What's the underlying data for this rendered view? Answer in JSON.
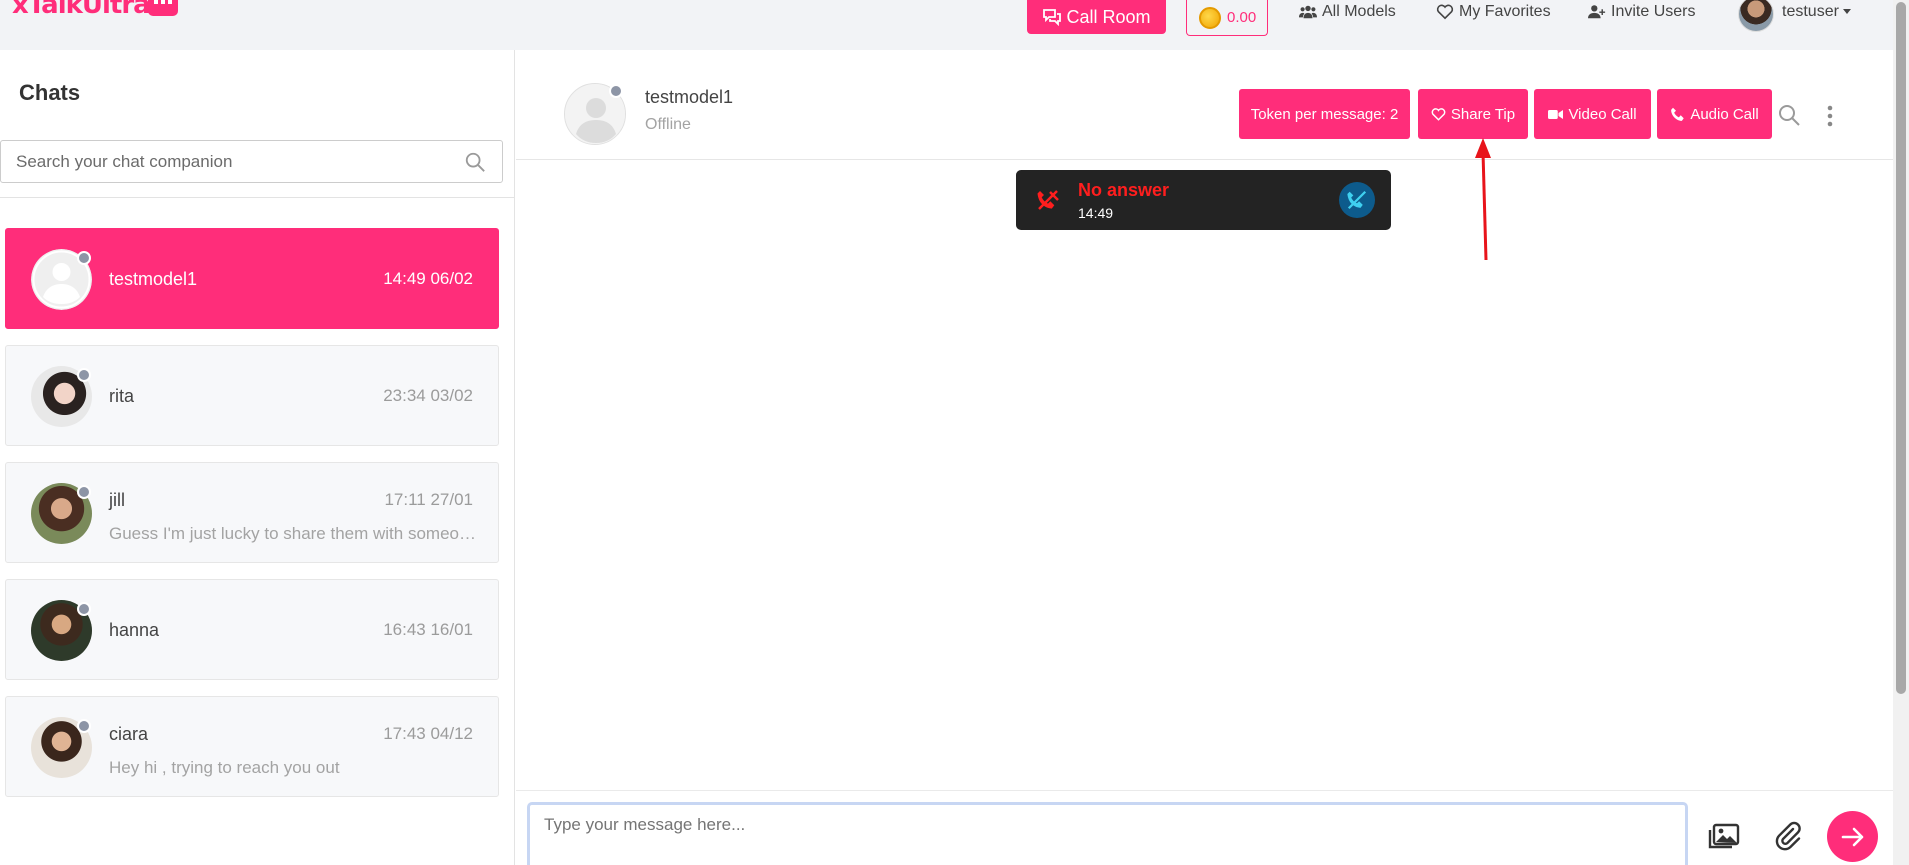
{
  "brand": {
    "logo_text": "xTalkUltra",
    "accent": "#ff2d7a"
  },
  "topbar": {
    "call_room": "Call Room",
    "token_balance": "0.00",
    "all_models": "All Models",
    "my_favorites": "My Favorites",
    "invite_users": "Invite Users",
    "username": "testuser"
  },
  "sidebar": {
    "title": "Chats",
    "search_placeholder": "Search your chat companion",
    "chats": [
      {
        "name": "testmodel1",
        "time": "14:49 06/02",
        "preview": "",
        "active": true
      },
      {
        "name": "rita",
        "time": "23:34 03/02",
        "preview": ""
      },
      {
        "name": "jill",
        "time": "17:11 27/01",
        "preview": "Guess I'm just lucky to share them with someone special"
      },
      {
        "name": "hanna",
        "time": "16:43 16/01",
        "preview": ""
      },
      {
        "name": "ciara",
        "time": "17:43 04/12",
        "preview": "Hey hi , trying to reach you out"
      }
    ]
  },
  "chat": {
    "contact_name": "testmodel1",
    "contact_status": "Offline",
    "token_per_message": "Token per message: 2",
    "share_tip": "Share Tip",
    "video_call": "Video Call",
    "audio_call": "Audio Call",
    "call_event": {
      "title": "No answer",
      "time": "14:49"
    },
    "composer_placeholder": "Type your message here..."
  }
}
